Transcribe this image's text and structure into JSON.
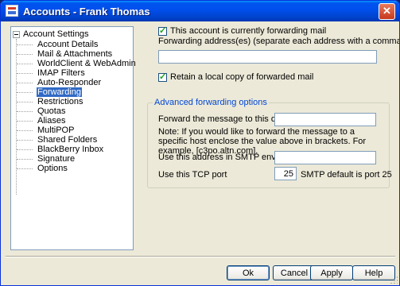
{
  "window": {
    "title": "Accounts - Frank Thomas",
    "close_glyph": "✕"
  },
  "tree": {
    "root": "Account Settings",
    "items": [
      {
        "label": "Account Details"
      },
      {
        "label": "Mail & Attachments"
      },
      {
        "label": "WorldClient & WebAdmin"
      },
      {
        "label": "IMAP Filters"
      },
      {
        "label": "Auto-Responder"
      },
      {
        "label": "Forwarding",
        "selected": true
      },
      {
        "label": "Restrictions"
      },
      {
        "label": "Quotas"
      },
      {
        "label": "Aliases"
      },
      {
        "label": "MultiPOP"
      },
      {
        "label": "Shared Folders"
      },
      {
        "label": "BlackBerry Inbox"
      },
      {
        "label": "Signature"
      },
      {
        "label": "Options"
      }
    ]
  },
  "forwarding": {
    "enabled_label": "This account is currently forwarding mail",
    "enabled_checked": true,
    "addresses_label": "Forwarding address(es) (separate each address with a comma)",
    "addresses_value": "",
    "retain_label": "Retain a local copy of forwarded mail",
    "retain_checked": true
  },
  "advanced": {
    "title": "Advanced forwarding options",
    "domain_label": "Forward the message to this domain",
    "domain_value": "",
    "note": "Note:  If you would like to forward the message to a specific host enclose the value above in brackets.  For example, [c3po.altn.com].",
    "smtp_label": "Use this address in SMTP envelope",
    "smtp_value": "",
    "port_label": "Use this TCP port",
    "port_value": "25",
    "port_hint": "SMTP default is port 25"
  },
  "buttons": {
    "ok": "Ok",
    "cancel": "Cancel",
    "apply": "Apply",
    "help": "Help"
  },
  "icons": {
    "expander": "minus-box-icon",
    "checkbox_mark": "checkmark-icon"
  },
  "colors": {
    "titlebar": "#0053ee",
    "selection": "#316ac5",
    "group_title": "#0046d5",
    "dialog_bg": "#ece9d8"
  }
}
